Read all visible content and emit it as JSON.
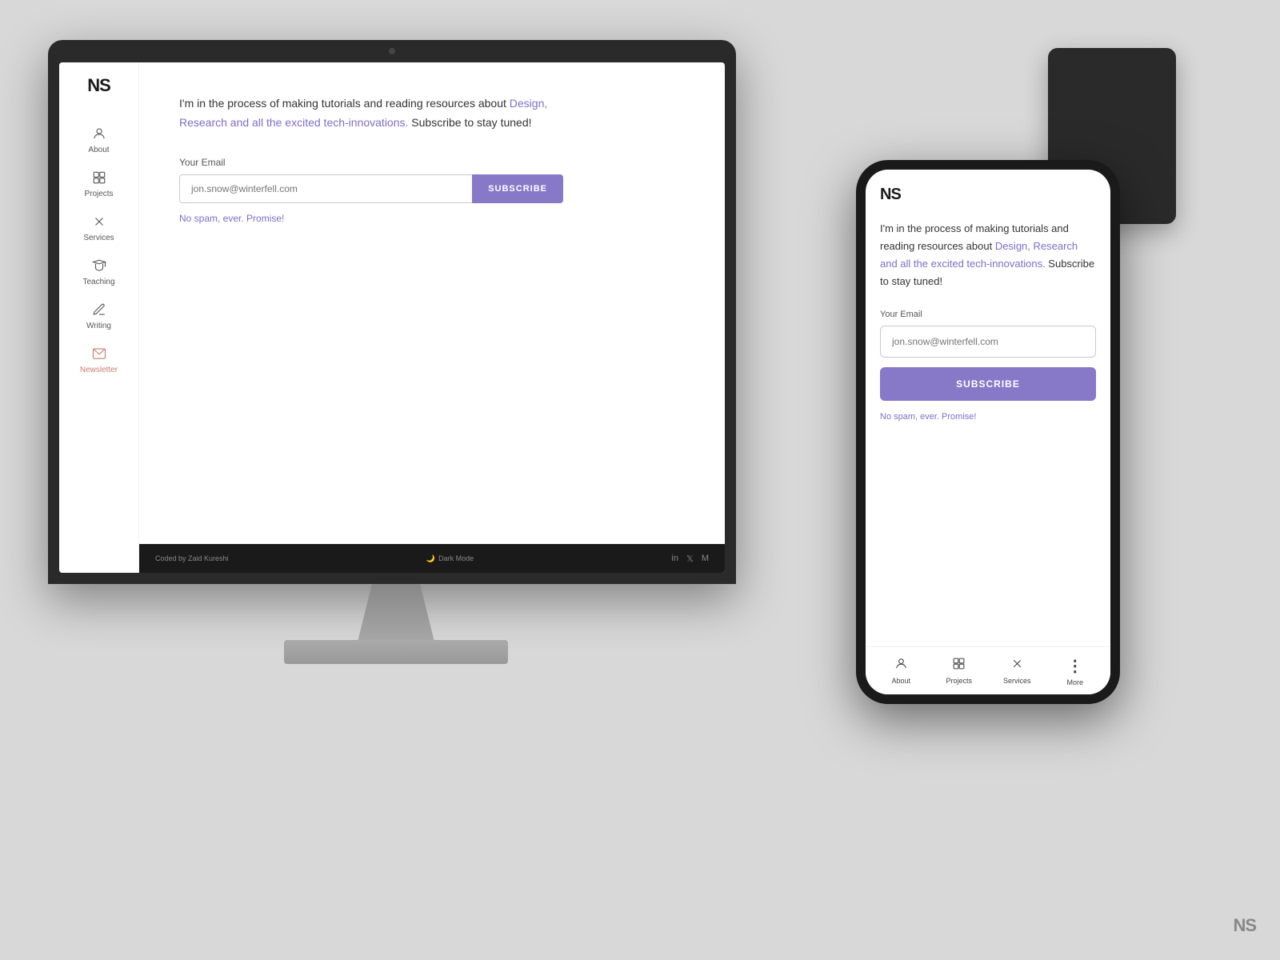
{
  "brand": {
    "logo": "NS",
    "watermark": "NS"
  },
  "desktop": {
    "sidebar": {
      "items": [
        {
          "label": "About",
          "icon": "👤",
          "id": "about"
        },
        {
          "label": "Projects",
          "icon": "◈",
          "id": "projects"
        },
        {
          "label": "Services",
          "icon": "✕",
          "id": "services"
        },
        {
          "label": "Teaching",
          "icon": "✎",
          "id": "teaching"
        },
        {
          "label": "Writing",
          "icon": "✒",
          "id": "writing"
        },
        {
          "label": "Newsletter",
          "icon": "⊞",
          "id": "newsletter",
          "active": true
        }
      ]
    },
    "content": {
      "intro_text": "I'm in the process of making tutorials and reading resources about ",
      "highlight": "Design, Research and all the excited tech-innovations.",
      "outro": " Subscribe to stay tuned!",
      "email_label": "Your Email",
      "email_placeholder": "jon.snow@winterfell.com",
      "subscribe_label": "SUBSCRIBE",
      "no_spam": "No spam, ever. Promise!"
    },
    "footer": {
      "coded_by": "Coded by Zaid Kureshi",
      "dark_mode": "Dark Mode",
      "socials": [
        "in",
        "🐦",
        "M"
      ]
    }
  },
  "mobile": {
    "logo": "NS",
    "content": {
      "intro_text": "I'm in the process of making tutorials and reading resources about ",
      "highlight": "Design, Research and all the excited tech-innovations.",
      "outro": " Subscribe to stay tuned!",
      "email_label": "Your Email",
      "email_placeholder": "jon.snow@winterfell.com",
      "subscribe_label": "SUBSCRIBE",
      "no_spam": "No spam, ever. Promise!"
    },
    "bottom_nav": [
      {
        "label": "About",
        "icon": "👤"
      },
      {
        "label": "Projects",
        "icon": "◈"
      },
      {
        "label": "Services",
        "icon": "✕"
      },
      {
        "label": "More",
        "icon": "⋮"
      }
    ]
  }
}
